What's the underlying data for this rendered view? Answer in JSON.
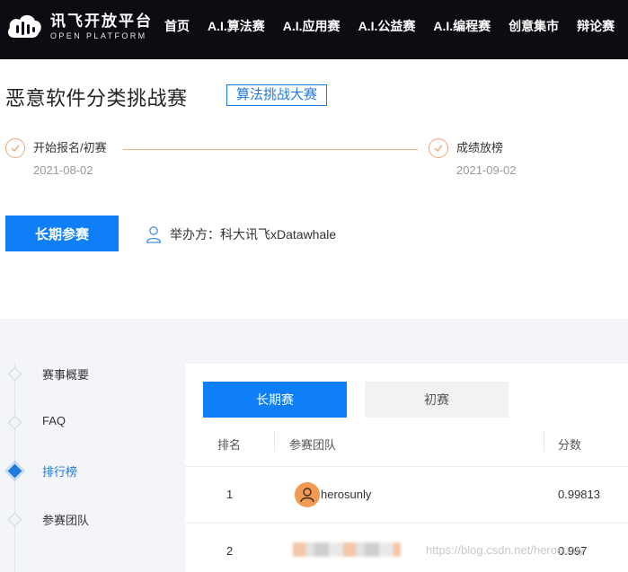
{
  "brand": {
    "cn": "讯飞开放平台",
    "en": "OPEN PLATFORM"
  },
  "nav": [
    "首页",
    "A.I.算法赛",
    "A.I.应用赛",
    "A.I.公益赛",
    "A.I.编程赛",
    "创意集市",
    "辩论赛"
  ],
  "competition": {
    "title": "恶意软件分类挑战赛",
    "tag": "算法挑战大赛",
    "steps": [
      {
        "label": "开始报名/初赛",
        "date": "2021-08-02"
      },
      {
        "label": "成绩放榜",
        "date": "2021-09-02"
      }
    ],
    "join_label": "长期参赛",
    "organizer": "举办方：科大讯飞xDatawhale"
  },
  "sidebar": {
    "items": [
      {
        "label": "赛事概要",
        "active": false
      },
      {
        "label": "FAQ",
        "active": false
      },
      {
        "label": "排行榜",
        "active": true
      },
      {
        "label": "参赛团队",
        "active": false
      }
    ]
  },
  "leaderboard": {
    "tabs": [
      {
        "label": "长期赛",
        "active": true
      },
      {
        "label": "初赛",
        "active": false
      }
    ],
    "columns": [
      "排名",
      "参赛团队",
      "分数"
    ],
    "rows": [
      {
        "rank": "1",
        "team": "herosunly",
        "score": "0.99813"
      },
      {
        "rank": "2",
        "team": "",
        "score": "0.997"
      }
    ]
  },
  "watermark": "https://blog.csdn.net/herosunly",
  "colors": {
    "accent": "#0f7ff7",
    "step": "#f0a67a",
    "topbar": "#0b0d12",
    "avatar": "#f39a52"
  }
}
